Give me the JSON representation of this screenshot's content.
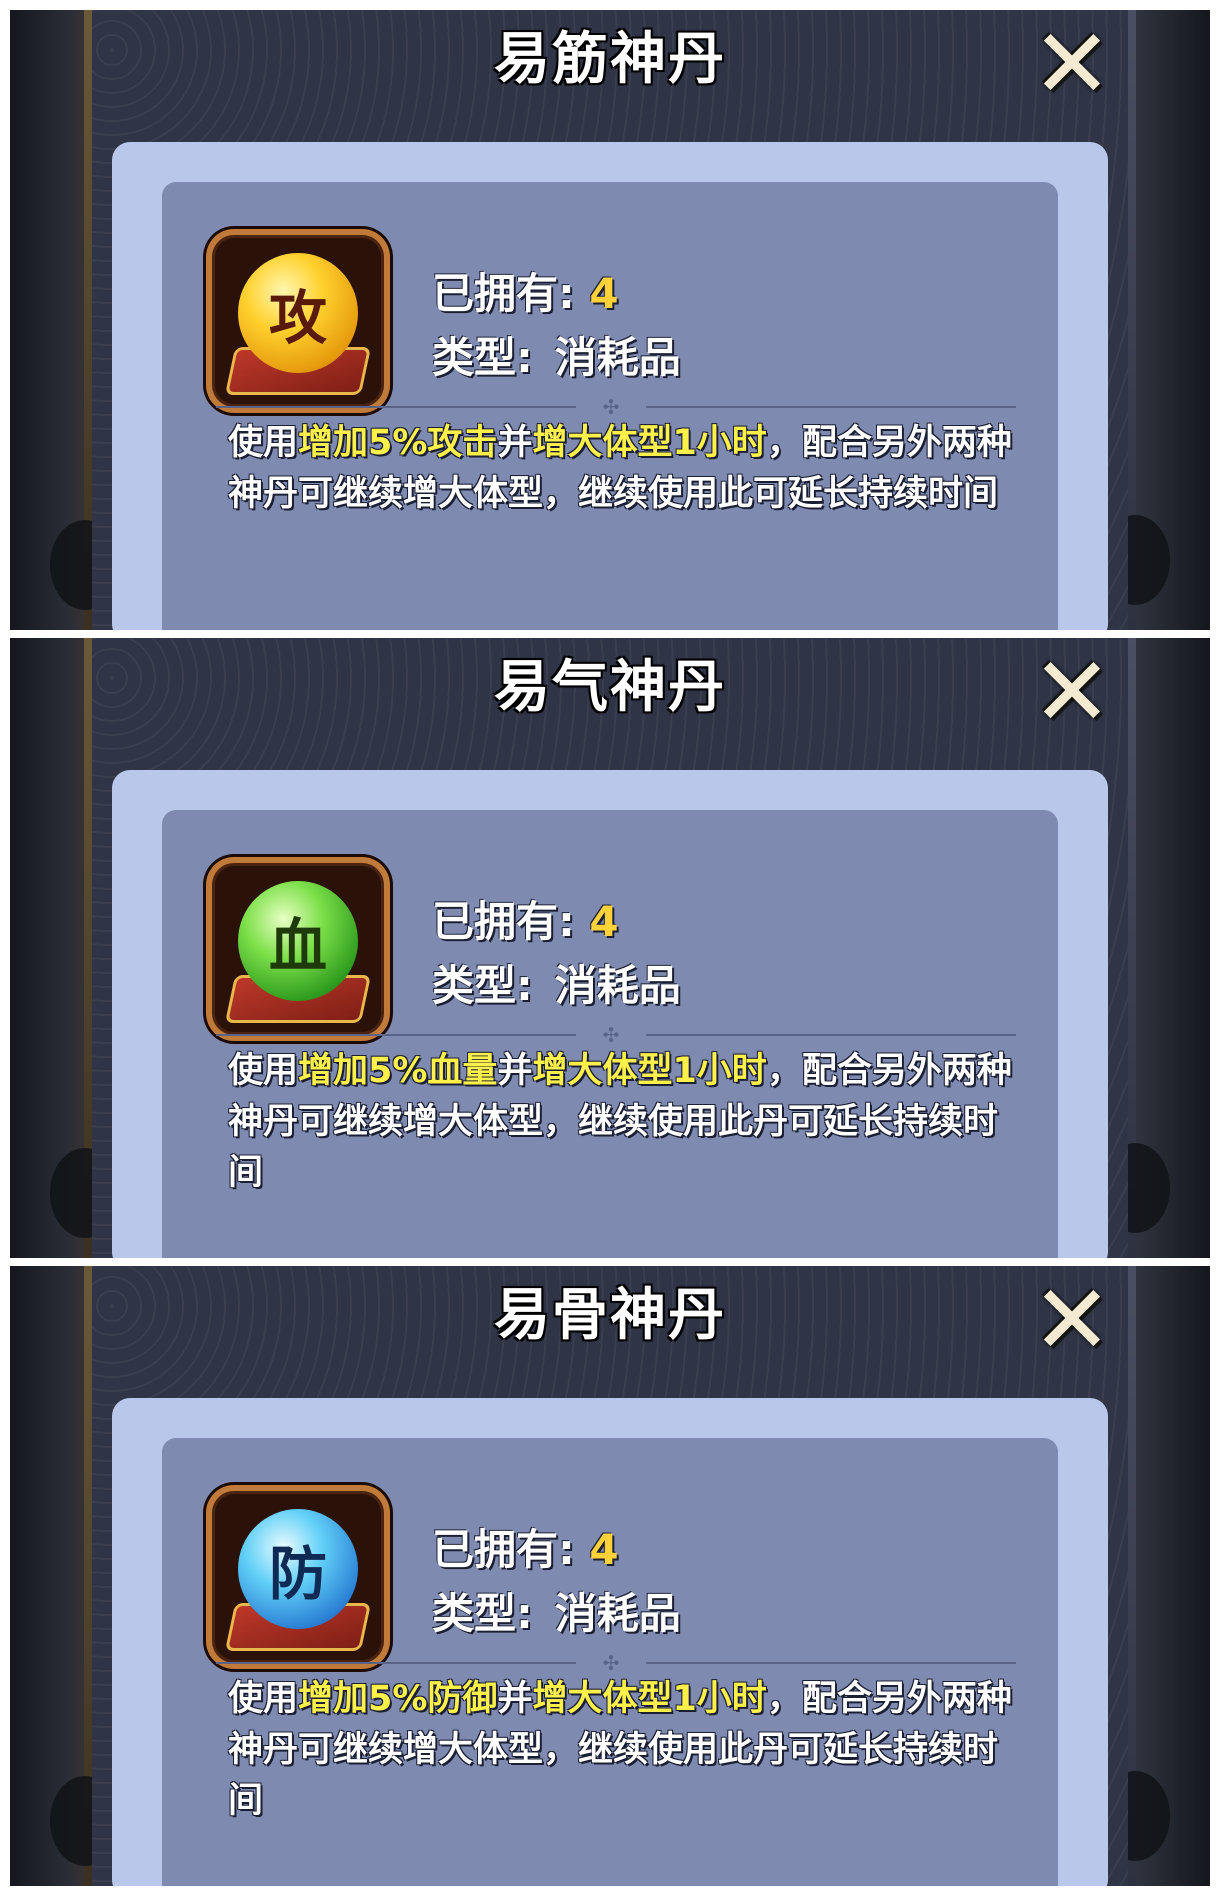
{
  "panels": [
    {
      "title": "易筋神丹",
      "close_icon": "✕",
      "item_icon": "attack-pill-icon",
      "orb_char": "攻",
      "orb_color": "#ffd12e",
      "owned_label": "已拥有:",
      "owned_value": "4",
      "type_label": "类型:",
      "type_value": "消耗品",
      "desc_prefix": "使用",
      "desc_hl1": "增加5%攻击",
      "desc_mid": "并",
      "desc_hl2": "增大体型1小时",
      "desc_rest": "，配合另外两种神丹可继续增大体型，继续使用此可延长持续时间"
    },
    {
      "title": "易气神丹",
      "close_icon": "✕",
      "item_icon": "blood-pill-icon",
      "orb_char": "血",
      "orb_color": "#7de04a",
      "owned_label": "已拥有:",
      "owned_value": "4",
      "type_label": "类型:",
      "type_value": "消耗品",
      "desc_prefix": "使用",
      "desc_hl1": "增加5%血量",
      "desc_mid": "并",
      "desc_hl2": "增大体型1小时",
      "desc_rest": "，配合另外两种神丹可继续增大体型，继续使用此丹可延长持续时间"
    },
    {
      "title": "易骨神丹",
      "close_icon": "✕",
      "item_icon": "defense-pill-icon",
      "orb_char": "防",
      "orb_color": "#62d0f7",
      "owned_label": "已拥有:",
      "owned_value": "4",
      "type_label": "类型:",
      "type_value": "消耗品",
      "desc_prefix": "使用",
      "desc_hl1": "增加5%防御",
      "desc_mid": "并",
      "desc_hl2": "增大体型1小时",
      "desc_rest": "，配合另外两种神丹可继续增大体型，继续使用此丹可延长持续时间"
    }
  ]
}
